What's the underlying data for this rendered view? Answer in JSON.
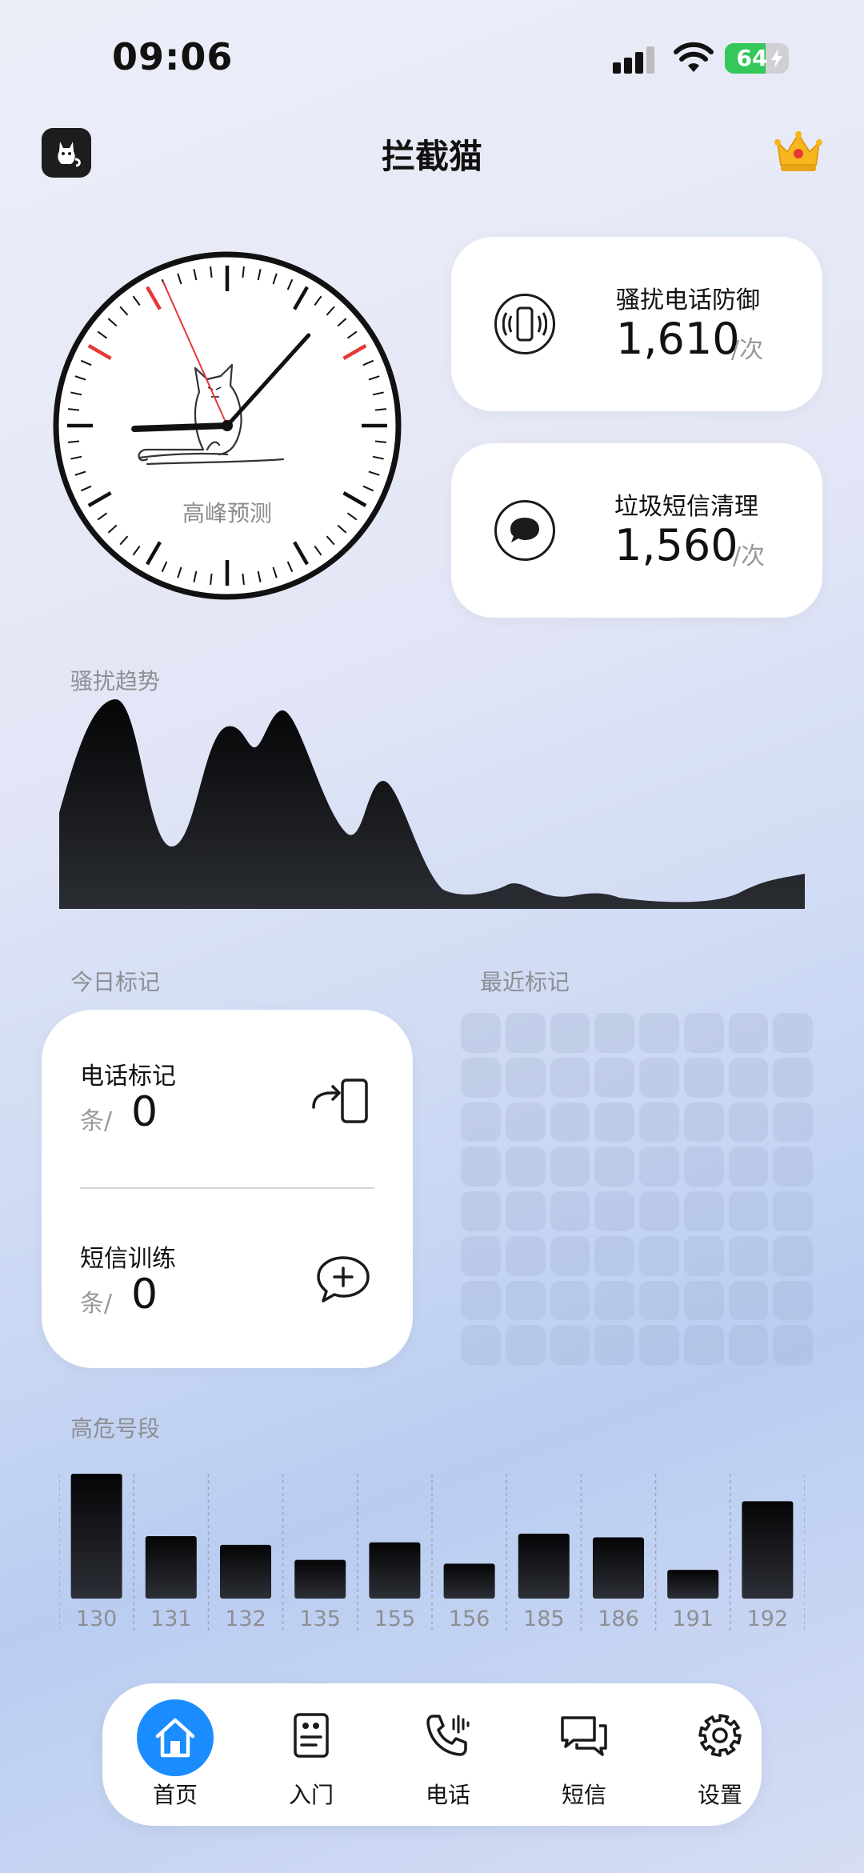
{
  "status_bar": {
    "time": "09:06",
    "battery": "64",
    "battery_level": 0.64
  },
  "header": {
    "title": "拦截猫"
  },
  "clock": {
    "label": "高峰预测"
  },
  "stats": [
    {
      "label": "骚扰电话防御",
      "value": "1,610",
      "unit": "/次",
      "icon": "phone-vibrate-icon"
    },
    {
      "label": "垃圾短信清理",
      "value": "1,560",
      "unit": "/次",
      "icon": "message-bubble-icon"
    }
  ],
  "trend": {
    "label": "骚扰趋势"
  },
  "today": {
    "label": "今日标记",
    "call_mark": {
      "title": "电话标记",
      "unit": "条/",
      "value": "0",
      "icon": "phone-forward-icon"
    },
    "sms_train": {
      "title": "短信训练",
      "unit": "条/",
      "value": "0",
      "icon": "message-add-icon"
    }
  },
  "recent": {
    "label": "最近标记"
  },
  "high_risk": {
    "label": "高危号段"
  },
  "chart_data": {
    "type": "bar",
    "categories": [
      "130",
      "131",
      "132",
      "135",
      "155",
      "156",
      "185",
      "186",
      "191",
      "192"
    ],
    "values": [
      100,
      50,
      43,
      31,
      45,
      28,
      52,
      49,
      23,
      78
    ],
    "ylim": [
      0,
      100
    ]
  },
  "tabs": [
    {
      "label": "首页",
      "icon": "home-icon",
      "active": true
    },
    {
      "label": "入门",
      "icon": "guide-icon",
      "active": false
    },
    {
      "label": "电话",
      "icon": "phone-icon",
      "active": false
    },
    {
      "label": "短信",
      "icon": "messages-icon",
      "active": false
    },
    {
      "label": "设置",
      "icon": "gear-icon",
      "active": false
    }
  ]
}
